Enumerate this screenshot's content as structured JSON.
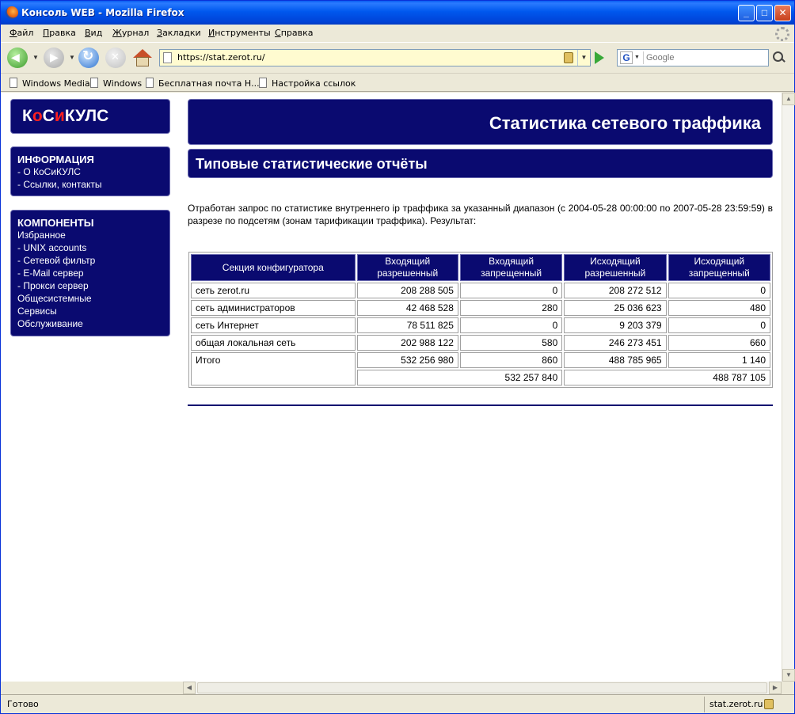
{
  "window": {
    "title": "Консоль WEB - Mozilla Firefox",
    "min_symbol": "_",
    "max_symbol": "□",
    "close_symbol": "✕"
  },
  "menu": [
    "Файл",
    "Правка",
    "Вид",
    "Журнал",
    "Закладки",
    "Инструменты",
    "Справка"
  ],
  "nav": {
    "url": "https://stat.zerot.ru/",
    "search_placeholder": "Google",
    "search_engine_letter": "G"
  },
  "bookmarks": [
    "Windows Media",
    "Windows",
    "Бесплатная почта Н...",
    "Настройка ссылок"
  ],
  "sidebar": {
    "logo_parts": [
      "К",
      "о",
      "С",
      "и",
      "КУЛС"
    ],
    "info": {
      "title": "ИНФОРМАЦИЯ",
      "links": [
        "- О КоСиКУЛС",
        "- Ссылки, контакты"
      ]
    },
    "components": {
      "title": "КОМПОНЕНТЫ",
      "links": [
        "Избранное",
        "- UNIX accounts",
        "- Сетевой фильтр",
        "- E-Mail сервер",
        "- Прокси сервер",
        "Общесистемные",
        "Сервисы",
        "Обслуживание"
      ]
    }
  },
  "header": {
    "title": "Статистика сетевого траффика",
    "subtitle": "Типовые статистические отчёты"
  },
  "description": "Отработан запрос по статистике внутреннего ip траффика за указанный диапазон (с 2004-05-28 00:00:00 по 2007-05-28 23:59:59) в разрезе по подсетям (зонам тарификации траффика). Результат:",
  "table": {
    "headers": [
      "Секция конфигуратора",
      "Входящий разрешенный",
      "Входящий запрещенный",
      "Исходящий разрешенный",
      "Исходящий запрещенный"
    ],
    "rows": [
      [
        "сеть zerot.ru",
        "208 288 505",
        "0",
        "208 272 512",
        "0"
      ],
      [
        "сеть администраторов",
        "42 468 528",
        "280",
        "25 036 623",
        "480"
      ],
      [
        "сеть Интернет",
        "78 511 825",
        "0",
        "9 203 379",
        "0"
      ],
      [
        "общая локальная сеть",
        "202 988 122",
        "580",
        "246 273 451",
        "660"
      ]
    ],
    "total_label": "Итого",
    "totals": [
      "532 256 980",
      "860",
      "488 785 965",
      "1 140"
    ],
    "grand_in": "532 257 840",
    "grand_out": "488 787 105"
  },
  "status": {
    "text": "Готово",
    "host": "stat.zerot.ru"
  }
}
